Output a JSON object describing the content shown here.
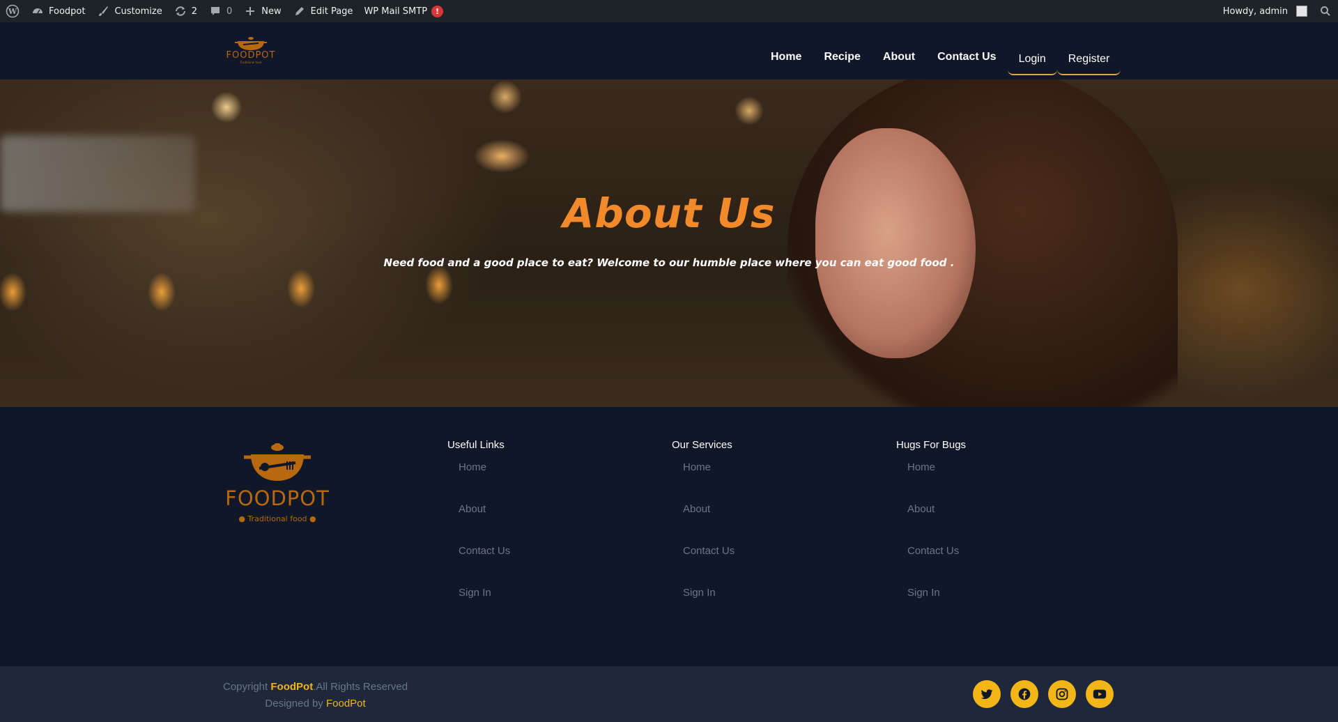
{
  "admin_bar": {
    "site_name": "Foodpot",
    "customize": "Customize",
    "updates_count": "2",
    "comments_count": "0",
    "new_label": "New",
    "edit_page": "Edit Page",
    "wp_mail_smtp": "WP Mail SMTP",
    "smtp_badge": "!",
    "howdy": "Howdy, admin",
    "icons": [
      "wordpress-icon",
      "dashboard-icon",
      "brush-icon",
      "update-icon",
      "comment-icon",
      "plus-icon",
      "pencil-icon",
      "search-icon"
    ]
  },
  "header": {
    "logo_text": "FOODPOT",
    "logo_tagline": "Traditional food",
    "nav": [
      {
        "label": "Home"
      },
      {
        "label": "Recipe"
      },
      {
        "label": "About"
      },
      {
        "label": "Contact Us"
      }
    ],
    "login": "Login",
    "register": "Register"
  },
  "hero": {
    "title": "About Us",
    "subtitle": "Need food and a good place to eat? Welcome to our humble place where you can eat good food ."
  },
  "footer": {
    "logo_text": "FOODPOT",
    "logo_tagline": "● Traditional food ●",
    "columns": [
      {
        "title": "Useful Links",
        "links": [
          "Home",
          "About",
          "Contact Us",
          "Sign In"
        ]
      },
      {
        "title": "Our Services",
        "links": [
          "Home",
          "About",
          "Contact Us",
          "Sign In"
        ]
      },
      {
        "title": "Hugs For Bugs",
        "links": [
          "Home",
          "About",
          "Contact Us",
          "Sign In"
        ]
      }
    ]
  },
  "bottom": {
    "copyright_prefix": "Copyright",
    "brand": "FoodPot",
    "rights": ".All Rights Reserved",
    "designed_by": "Designed by",
    "designer": "FoodPot",
    "socials": [
      "twitter-icon",
      "facebook-icon",
      "instagram-icon",
      "youtube-icon"
    ]
  },
  "colors": {
    "accent": "#f28a2b",
    "gold": "#f2b619",
    "logo": "#b8680f",
    "background": "#0f1729",
    "bottom_bar": "#1e283a",
    "admin_bar": "#1d2327"
  }
}
